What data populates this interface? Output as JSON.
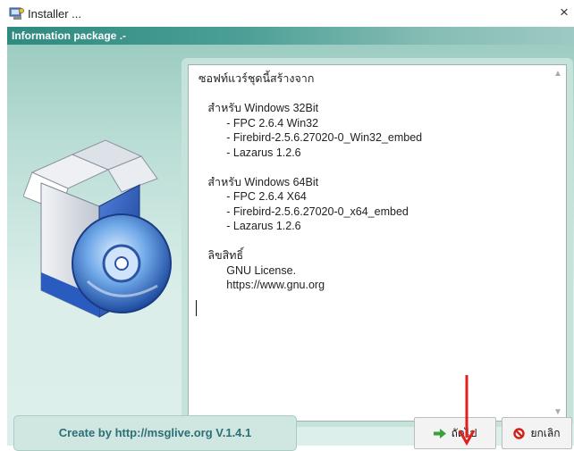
{
  "window": {
    "title": "Installer ...",
    "close_glyph": "×"
  },
  "header": {
    "title": "Information package .-"
  },
  "info_text": "ซอฟท์แวร์ชุดนี้สร้างจาก\n\n   สำหรับ Windows 32Bit\n         - FPC 2.6.4 Win32\n         - Firebird-2.5.6.27020-0_Win32_embed\n         - Lazarus 1.2.6\n\n   สำหรับ Windows 64Bit\n         - FPC 2.6.4 X64\n         - Firebird-2.5.6.27020-0_x64_embed\n         - Lazarus 1.2.6\n\n   ลิขสิทธิ์\n         GNU License.\n         https://www.gnu.org",
  "footer": {
    "credit": "Create by http://msglive.org  V.1.4.1"
  },
  "buttons": {
    "next_label": "ถัดไป",
    "cancel_label": "ยกเลิก"
  },
  "icons": {
    "app": "installer-app-icon",
    "next": "green-arrow-right-icon",
    "cancel": "red-prohibited-icon",
    "product": "software-box-with-cd-image"
  },
  "colors": {
    "header_band": "#2f8a80",
    "credit_text": "#2d6f77",
    "annotation_arrow": "#e0201a"
  }
}
